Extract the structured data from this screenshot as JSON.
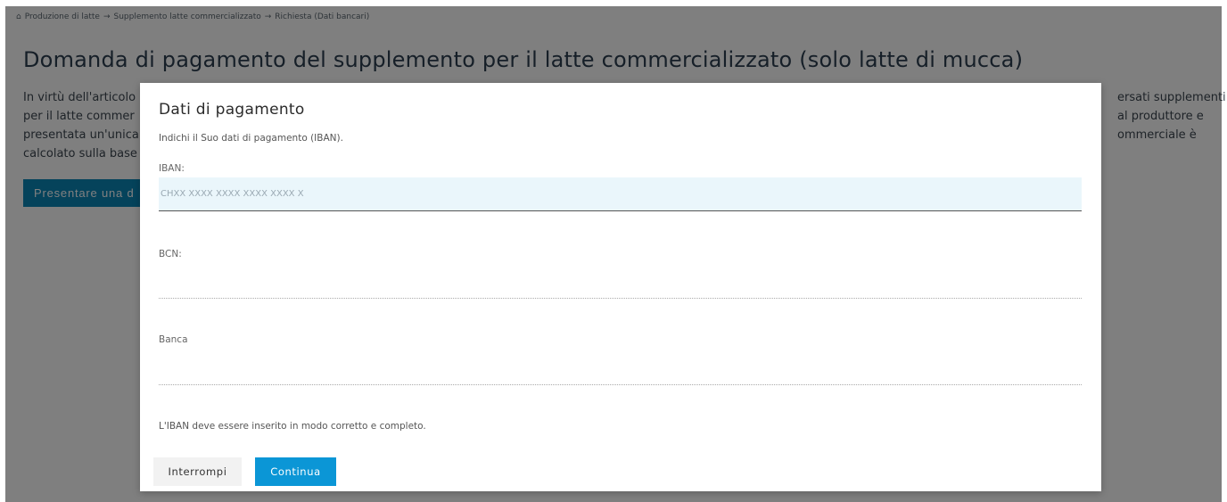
{
  "breadcrumb": {
    "items": [
      "Produzione di latte",
      "Supplemento latte commercializzato",
      "Richiesta (Dati bancari)"
    ],
    "separator": "→"
  },
  "page": {
    "title": "Domanda di pagamento del supplemento per il latte commercializzato (solo latte di mucca)",
    "intro_lines_left": [
      "In virtù dell'articolo",
      "per il latte commer",
      "presentata un'unica",
      "calcolato sulla base"
    ],
    "intro_lines_right": [
      "ersati supplementi",
      "al produttore e",
      "ommerciale è",
      ""
    ],
    "button_label": "Presentare una d"
  },
  "modal": {
    "title": "Dati di pagamento",
    "description": "Indichi il Suo dati di pagamento (IBAN).",
    "iban_label": "IBAN:",
    "iban_placeholder": "CHXX XXXX XXXX XXXX XXXX X",
    "iban_value": "",
    "bcn_label": "BCN:",
    "bcn_value": "",
    "bank_label": "Banca",
    "bank_value": "",
    "hint": "L'IBAN deve essere inserito in modo corretto e completo.",
    "cancel_label": "Interrompi",
    "continue_label": "Continua"
  },
  "colors": {
    "primary": "#0b96d6",
    "input_bg": "#eaf6fb",
    "overlay": "rgba(0,0,0,0.5)"
  }
}
